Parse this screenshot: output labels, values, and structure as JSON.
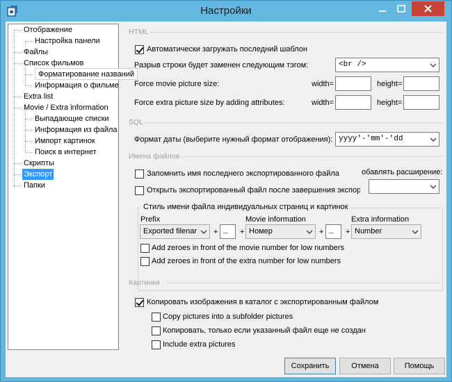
{
  "window": {
    "title": "Настройки"
  },
  "tree": {
    "items": [
      {
        "label": "Отображение"
      },
      {
        "label": "Настройка панели"
      },
      {
        "label": "Файлы"
      },
      {
        "label": "Список фильмов"
      },
      {
        "label": "Форматирование названий"
      },
      {
        "label": "Информация о фильме"
      },
      {
        "label": "Extra list"
      },
      {
        "label": "Movie / Extra information"
      },
      {
        "label": "Выпадающие списки"
      },
      {
        "label": "Информация из файла"
      },
      {
        "label": "Импорт картинок"
      },
      {
        "label": "Поиск в интернет"
      },
      {
        "label": "Скрипты"
      },
      {
        "label": "Экспорт"
      },
      {
        "label": "Папки"
      }
    ]
  },
  "html_section": {
    "title": "HTML",
    "autoload_label": "Автоматически загружать последний шаблон",
    "autoload_checked": true,
    "linebreak_label": "Разрыв строки будет заменен следующим тэгом:",
    "linebreak_value": "<br />",
    "force_movie_label": "Force movie picture size:",
    "force_extra_label": "Force extra picture size by adding attributes:",
    "width_label": "width=",
    "height_label": "height="
  },
  "sql_section": {
    "title": "SQL",
    "date_format_label": "Формат даты (выберите нужный формат отображения):",
    "date_format_value": "yyyy'-'mm'-'dd"
  },
  "filenames_section": {
    "title": "Имена файлов",
    "remember_label": "Запомнить имя последнего экспортированного файла",
    "remember_checked": false,
    "open_label": "Открыть экспортированный файл после завершения экспор",
    "open_checked": false,
    "add_ext_label": "обавлять расширение:",
    "add_ext_value": "",
    "group_title": "Стиль имени файла индивидуальных страниц и картинок",
    "prefix_label": "Prefix",
    "prefix_value": "Exported filenar",
    "plus": "+",
    "sep1_value": "_",
    "movie_info_label": "Movie information",
    "movie_info_value": "Номер",
    "sep2_value": "_",
    "extra_info_label": "Extra information",
    "extra_info_value": "Number",
    "zeroes_movie_label": "Add zeroes in front of the movie number for low numbers",
    "zeroes_movie_checked": false,
    "zeroes_extra_label": "Add zeroes in front of the extra number for low numbers",
    "zeroes_extra_checked": false
  },
  "pictures_section": {
    "title": "Картинки",
    "copy_label": "Копировать изображения в каталог с экспортированным файлом",
    "copy_checked": true,
    "subfolder_label": "Copy pictures into a subfolder pictures",
    "subfolder_checked": false,
    "only_if_label": "Копировать, только если указанный файл еще не создан",
    "only_if_checked": false,
    "include_extra_label": "Include extra pictures",
    "include_extra_checked": false
  },
  "buttons": {
    "save": "Сохранить",
    "cancel": "Отмена",
    "help": "Помощь"
  }
}
